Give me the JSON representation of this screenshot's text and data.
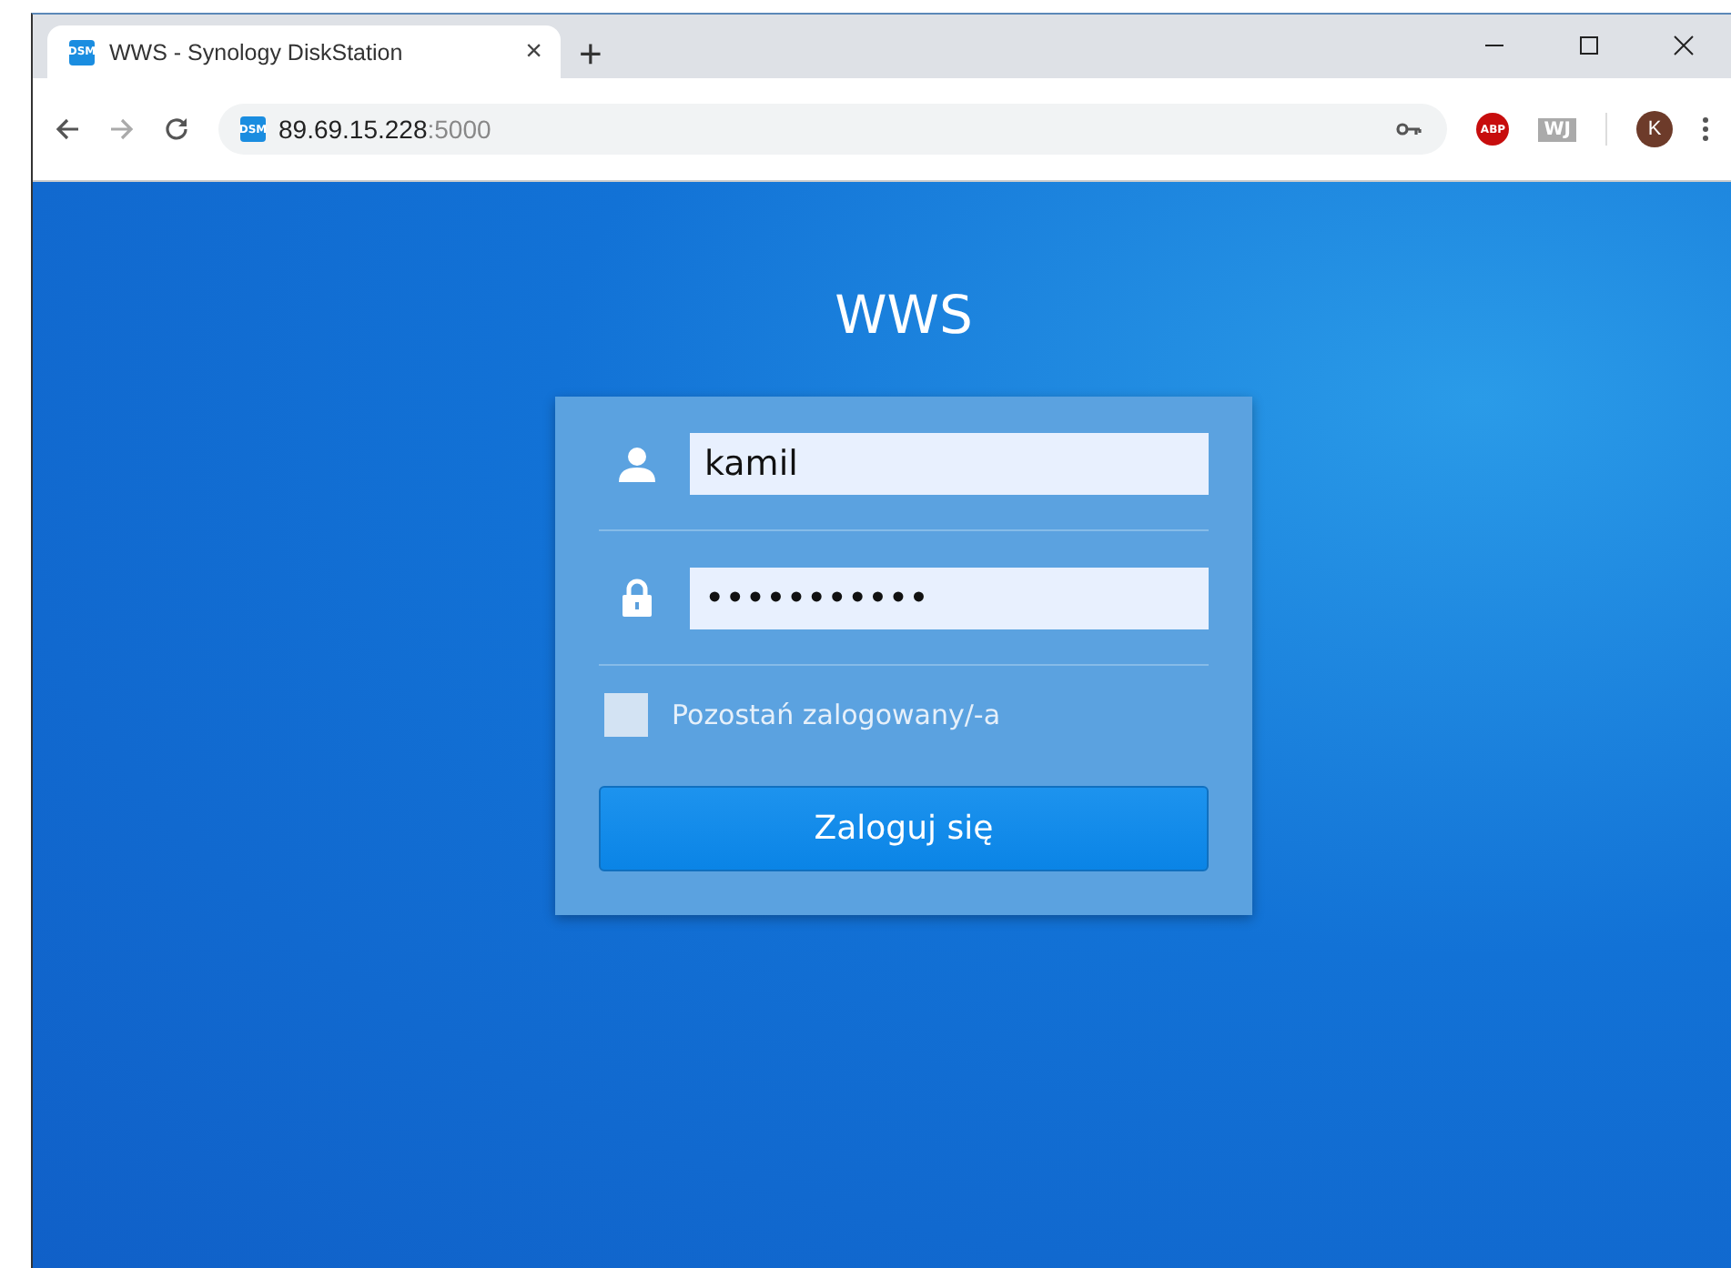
{
  "browser": {
    "tab": {
      "favicon": "DSM",
      "title": "WWS - Synology DiskStation",
      "close": "×",
      "selected": true
    },
    "new_tab": "+",
    "address": {
      "favicon": "DSM",
      "host": "89.69.15.228",
      "port": ":5000"
    },
    "extensions": [
      {
        "kind": "abp",
        "label": "ABP"
      },
      {
        "kind": "wj",
        "label": "WJ"
      }
    ],
    "profile": "K"
  },
  "login": {
    "title": "WWS",
    "fields": [
      {
        "kind": "user",
        "value": "kamil"
      },
      {
        "kind": "password",
        "value": "•••••••••••"
      }
    ],
    "remember": {
      "label": "Pozostań zalogowany/-a",
      "checked": false
    },
    "button": "Zaloguj się"
  }
}
